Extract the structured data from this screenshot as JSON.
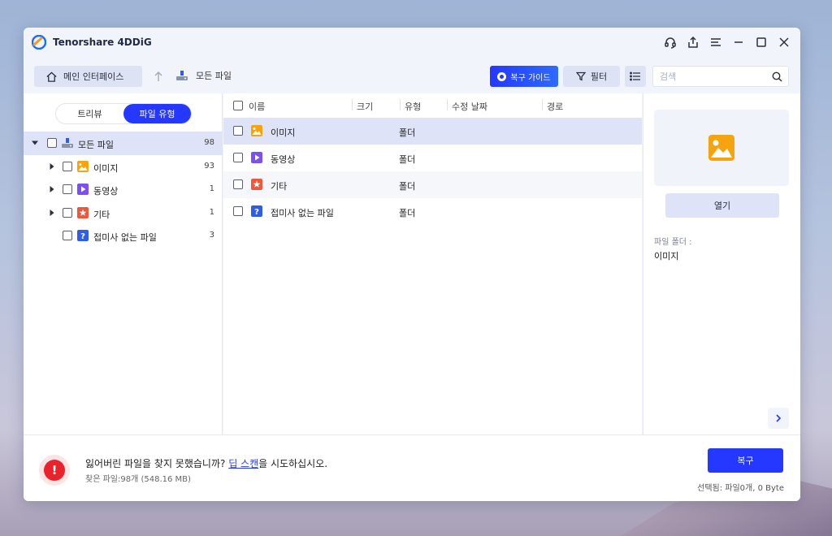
{
  "app": {
    "title": "Tenorshare 4DDiG"
  },
  "toolbar": {
    "home_label": "메인 인터페이스",
    "breadcrumb": "모든 파일",
    "guide_label": "복구 가이드",
    "filter_label": "필터",
    "search_placeholder": "검색"
  },
  "sidebar": {
    "toggle": {
      "tree_view": "트리뷰",
      "file_type": "파일 유형",
      "active": "file_type"
    },
    "items": [
      {
        "label": "모든 파일",
        "count": "98",
        "icon": "drive-icon"
      },
      {
        "label": "이미지",
        "count": "93",
        "icon": "image-icon"
      },
      {
        "label": "동영상",
        "count": "1",
        "icon": "video-icon"
      },
      {
        "label": "기타",
        "count": "1",
        "icon": "star-icon"
      },
      {
        "label": "접미사 없는 파일",
        "count": "3",
        "icon": "question-icon"
      }
    ]
  },
  "file_list": {
    "columns": {
      "name": "이름",
      "size": "크기",
      "type": "유형",
      "modified": "수정 날짜",
      "path": "경로"
    },
    "rows": [
      {
        "name": "이미지",
        "type": "폴더",
        "icon": "image-icon"
      },
      {
        "name": "동영상",
        "type": "폴더",
        "icon": "video-icon"
      },
      {
        "name": "기타",
        "type": "폴더",
        "icon": "star-icon"
      },
      {
        "name": "접미사 없는 파일",
        "type": "폴더",
        "icon": "question-icon"
      }
    ]
  },
  "preview": {
    "open_label": "열기",
    "folder_label": "파일 폴더 :",
    "folder_value": "이미지"
  },
  "bottom": {
    "message_prefix": "잃어버린 파일을 찾지 못했습니까? ",
    "message_link": "딥 스캔",
    "message_suffix": "을 시도하십시오.",
    "found": "찾은 파일:98개 (548.16 MB)",
    "recover_label": "복구",
    "selected": "선택됨: 파일0개, 0 Byte"
  },
  "colors": {
    "accent": "#2438ff",
    "selected_row": "#dfe3f8",
    "warning": "#e8232b",
    "image": "#f5a40f",
    "video": "#7b4ff0",
    "other": "#f0573a",
    "unknown": "#2f5de8"
  }
}
